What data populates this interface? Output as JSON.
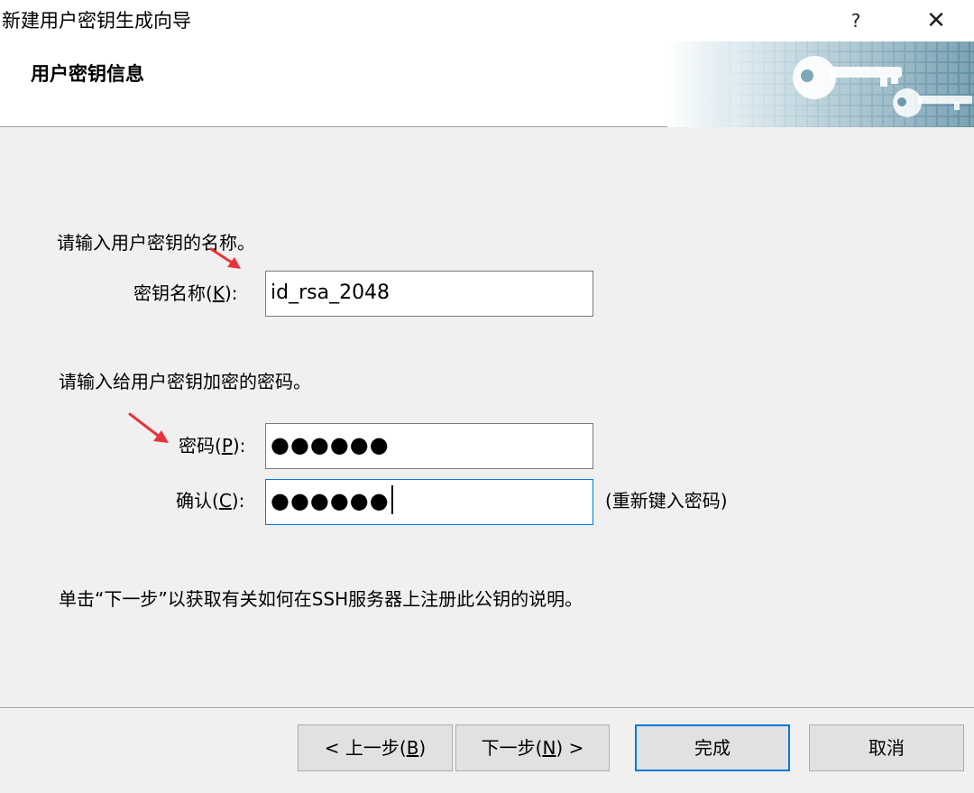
{
  "window": {
    "title": "新建用户密钥生成向导",
    "help_glyph": "?",
    "close_glyph": "✕"
  },
  "header": {
    "title": "用户密钥信息",
    "art_icon": "keys-banner-icon"
  },
  "key_name": {
    "instruction": "请输入用户密钥的名称。",
    "label": "密钥名称(",
    "mnemonic": "K",
    "label_end": "):",
    "value": "id_rsa_2048"
  },
  "passphrase": {
    "instruction": "请输入给用户密钥加密的密码。",
    "password_label": "密码(",
    "password_mnemonic": "P",
    "password_label_end": "):",
    "password_value": "●●●●●●",
    "confirm_label": "确认(",
    "confirm_mnemonic": "C",
    "confirm_label_end": "):",
    "confirm_value": "●●●●●●",
    "confirm_hint": "(重新键入密码)"
  },
  "note": "单击“下一步”以获取有关如何在SSH服务器上注册此公钥的说明。",
  "footer": {
    "back_prefix": "< 上一步(",
    "back_mnemonic": "B",
    "back_suffix": ")",
    "next_prefix": "下一步(",
    "next_mnemonic": "N",
    "next_suffix": ") >",
    "finish": "完成",
    "cancel": "取消"
  },
  "colors": {
    "accent": "#0078d7",
    "annotation_arrow": "#e8333a"
  }
}
